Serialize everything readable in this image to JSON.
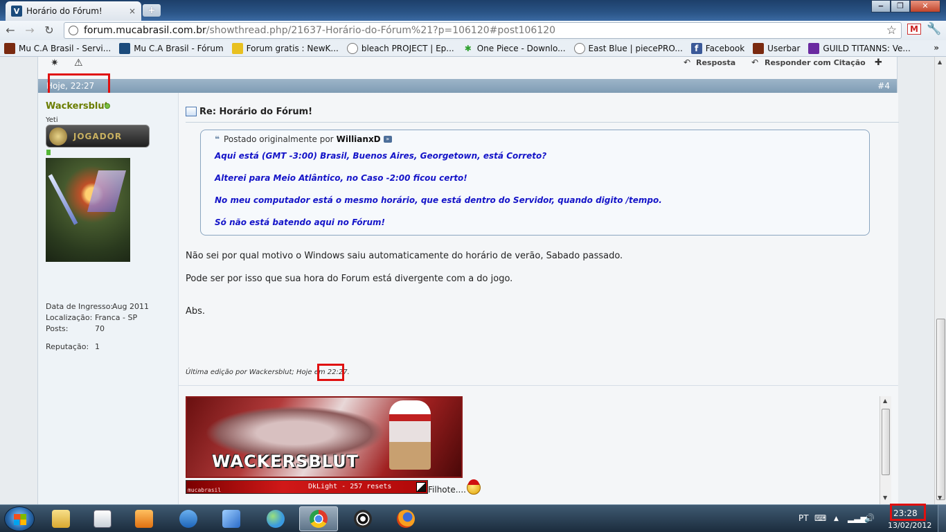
{
  "browser": {
    "tab_title": "Horário do Fórum!",
    "tab_close": "×",
    "tab_favicon": "V",
    "new_tab": "+",
    "window_buttons": {
      "minimize": "‒",
      "maximize": "❐",
      "close": "✕"
    },
    "nav": {
      "back": "←",
      "forward": "→",
      "reload": "↻"
    },
    "url_host": "forum.mucabrasil.com.br",
    "url_path": "/showthread.php/21637-Horário-do-Fórum%21?p=106120#post106120",
    "star": "☆",
    "gmail": "M",
    "wrench": "🔧",
    "bookmarks_more": "»",
    "bookmarks": [
      {
        "label": "Mu C.A Brasil - Servi...",
        "icon": "mu-icon",
        "color": "#7a2a10"
      },
      {
        "label": "Mu C.A Brasil - Fórum",
        "icon": "vbulletin-icon",
        "color": "#1b4b7c"
      },
      {
        "label": "Forum gratis : NewK...",
        "icon": "forumgratis-icon",
        "color": "#e8c020"
      },
      {
        "label": "bleach PROJECT | Ep...",
        "icon": "globe-icon",
        "color": "#777777"
      },
      {
        "label": "One Piece - Downlo...",
        "icon": "star-icon",
        "color": "#2ca02c"
      },
      {
        "label": "East Blue | piecePRO...",
        "icon": "globe-icon",
        "color": "#777777"
      },
      {
        "label": "Facebook",
        "icon": "facebook-icon",
        "color": "#3b5998"
      },
      {
        "label": "Userbar",
        "icon": "mu-icon",
        "color": "#7a2a10"
      },
      {
        "label": "GUILD TITANNS: Ve...",
        "icon": "guild-icon",
        "color": "#6a2aa0"
      }
    ]
  },
  "page": {
    "prev_post_actions": {
      "reply": "Resposta",
      "quote_reply": "Responder com Citação"
    },
    "post": {
      "date": "Hoje, 22:27",
      "number": "#4",
      "author": {
        "name": "Wackersblut",
        "title": "Yeti",
        "rank": "JOGADOR",
        "fields": [
          {
            "label": "Data de Ingresso:",
            "value": "Aug 2011"
          },
          {
            "label": "Localização:",
            "value": "Franca - SP"
          },
          {
            "label": "Posts:",
            "value": "70"
          },
          {
            "label": "Reputação:",
            "value": "1"
          }
        ]
      },
      "title": "Re: Horário do Fórum!",
      "quote": {
        "prefix": "Postado originalmente por",
        "author": "WillianxD",
        "lines": [
          "Aqui está (GMT -3:00) Brasil, Buenos Aires, Georgetown, está Correto?",
          "Alterei para Meio Atlântico, no Caso -2:00 ficou certo!",
          "No meu computador está o mesmo horário, que está dentro do Servidor, quando digito /tempo.",
          "Só não está batendo aqui no Fórum!"
        ]
      },
      "body": [
        "Não sei por qual motivo o Windows saiu automaticamente do horário de verão, Sabado passado.",
        "Pode ser por isso que sua hora do Forum está divergente com a do jogo.",
        "Abs."
      ],
      "edited_prefix": "Última edição por Wackersblut; Hoje em",
      "edited_time": "22:27.",
      "signature": {
        "banner_name": "WACKERSBLUT",
        "userbar_site": "mucabrasil",
        "userbar_text": "DkLight - 257 resets",
        "caption": "Filhote...."
      }
    }
  },
  "taskbar": {
    "language": "PT",
    "time": "23:28",
    "date": "13/02/2012",
    "apps": [
      {
        "name": "explorer",
        "color": "#e8c050"
      },
      {
        "name": "notepad",
        "color": "#d8dde2"
      },
      {
        "name": "media-player",
        "color": "#f08a20"
      },
      {
        "name": "teamviewer",
        "color": "#1d74c8"
      },
      {
        "name": "network",
        "color": "#3a8ad8"
      },
      {
        "name": "messenger",
        "color": "#5aa0e0"
      },
      {
        "name": "chrome",
        "color": "#d8a020"
      },
      {
        "name": "eye-app",
        "color": "#2a2a2a"
      },
      {
        "name": "firefox",
        "color": "#e86a10"
      }
    ]
  },
  "highlight_color": "#e01010"
}
